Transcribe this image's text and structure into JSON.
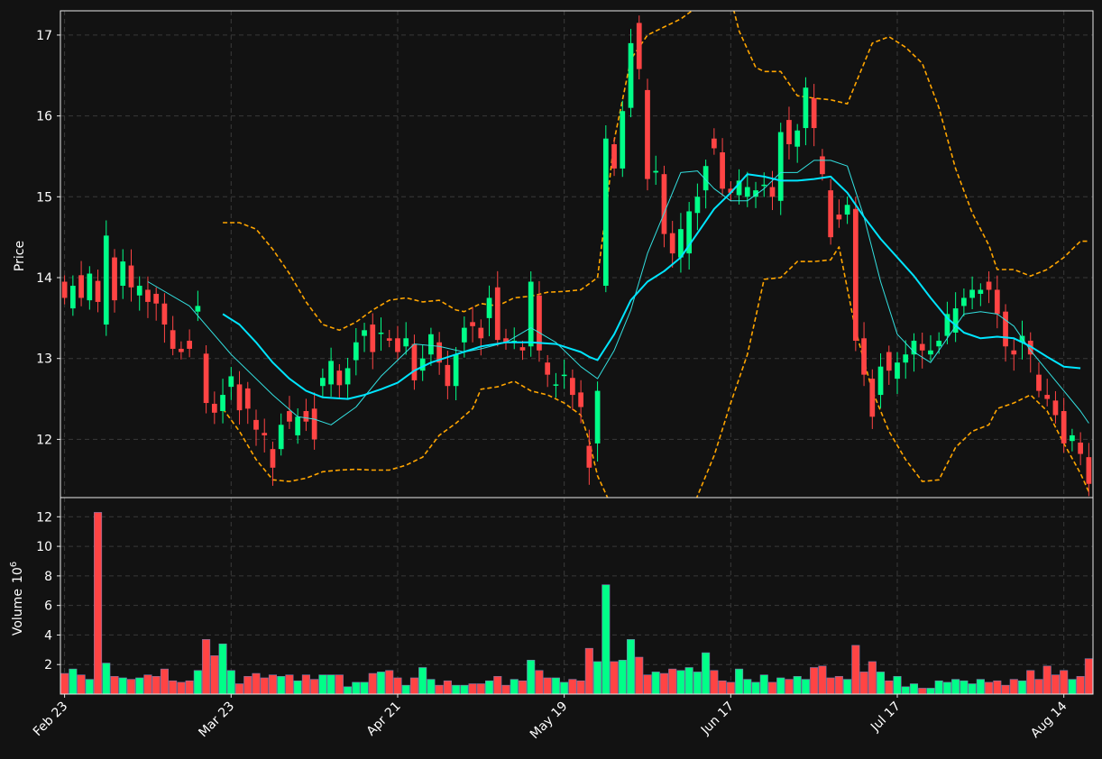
{
  "chart_data": {
    "type": "candlestick",
    "style": {
      "background": "#121212",
      "up_color": "#00ff88",
      "down_color": "#ff4444",
      "ma_fast_color": "#33e0e0",
      "ma_slow_color": "#00e5ff",
      "band_color": "#ffa500",
      "grid": true
    },
    "price_panel": {
      "ylabel": "Price",
      "yticks": [
        12,
        13,
        14,
        15,
        16,
        17
      ],
      "ylim": [
        11.28,
        17.3
      ]
    },
    "volume_panel": {
      "ylabel": "Volume",
      "ylabel_exponent": "6",
      "yticks": [
        2,
        4,
        6,
        8,
        10,
        12
      ],
      "ylim": [
        0,
        13.3
      ],
      "unit_multiplier": 1000000
    },
    "x_ticks": [
      {
        "index": 0,
        "label": "Feb 23"
      },
      {
        "index": 20,
        "label": "Mar 23"
      },
      {
        "index": 40,
        "label": "Apr 21"
      },
      {
        "index": 60,
        "label": "May 19"
      },
      {
        "index": 80,
        "label": "Jun 17"
      },
      {
        "index": 100,
        "label": "Jul 17"
      },
      {
        "index": 120,
        "label": "Aug 14"
      }
    ],
    "n_bars": 124,
    "bars": [
      [
        13.95,
        13.75
      ],
      [
        13.62,
        13.9
      ],
      [
        14.03,
        13.75
      ],
      [
        13.72,
        14.05
      ],
      [
        13.96,
        13.7
      ],
      [
        13.42,
        14.52
      ],
      [
        14.25,
        13.72
      ],
      [
        13.9,
        14.2
      ],
      [
        14.15,
        13.88
      ],
      [
        13.78,
        13.9
      ],
      [
        13.85,
        13.7
      ],
      [
        13.8,
        13.68
      ],
      [
        13.68,
        13.42
      ],
      [
        13.35,
        13.12
      ],
      [
        13.12,
        13.08
      ],
      [
        13.22,
        13.12
      ],
      [
        13.58,
        13.65
      ],
      [
        13.06,
        12.45
      ],
      [
        12.44,
        12.33
      ],
      [
        12.35,
        12.55
      ],
      [
        12.65,
        12.78
      ],
      [
        12.68,
        12.36
      ],
      [
        12.63,
        12.38
      ],
      [
        12.24,
        12.12
      ],
      [
        12.08,
        12.05
      ],
      [
        11.88,
        11.65
      ],
      [
        11.88,
        12.18
      ],
      [
        12.35,
        12.22
      ],
      [
        12.05,
        12.28
      ],
      [
        12.35,
        12.22
      ],
      [
        12.38,
        12.0
      ],
      [
        12.66,
        12.76
      ],
      [
        12.68,
        12.97
      ],
      [
        12.85,
        12.67
      ],
      [
        12.68,
        12.88
      ],
      [
        12.98,
        13.2
      ],
      [
        13.28,
        13.35
      ],
      [
        13.42,
        13.08
      ],
      [
        13.32,
        13.32
      ],
      [
        13.25,
        13.22
      ],
      [
        13.25,
        13.08
      ],
      [
        13.15,
        13.25
      ],
      [
        13.18,
        12.73
      ],
      [
        12.85,
        13.0
      ],
      [
        13.05,
        13.3
      ],
      [
        13.2,
        12.95
      ],
      [
        12.92,
        12.66
      ],
      [
        12.66,
        13.05
      ],
      [
        13.2,
        13.38
      ],
      [
        13.45,
        13.4
      ],
      [
        13.38,
        13.25
      ],
      [
        13.5,
        13.75
      ],
      [
        13.88,
        13.23
      ],
      [
        13.25,
        13.2
      ],
      [
        13.22,
        13.22
      ],
      [
        13.14,
        13.1
      ],
      [
        13.15,
        13.95
      ],
      [
        13.78,
        13.1
      ],
      [
        12.95,
        12.8
      ],
      [
        12.68,
        12.68
      ],
      [
        12.8,
        12.8
      ],
      [
        12.76,
        12.55
      ],
      [
        12.58,
        12.4
      ],
      [
        11.92,
        11.65
      ],
      [
        11.95,
        12.6
      ],
      [
        13.9,
        15.72
      ],
      [
        15.65,
        15.35
      ],
      [
        15.35,
        16.06
      ],
      [
        16.1,
        16.9
      ],
      [
        17.15,
        16.58
      ],
      [
        16.32,
        15.22
      ],
      [
        15.3,
        15.32
      ],
      [
        15.28,
        14.54
      ],
      [
        14.55,
        14.3
      ],
      [
        14.25,
        14.6
      ],
      [
        14.3,
        14.82
      ],
      [
        14.8,
        15.0
      ],
      [
        15.08,
        15.38
      ],
      [
        15.72,
        15.6
      ],
      [
        15.55,
        15.1
      ],
      [
        15.1,
        15.05
      ],
      [
        15.02,
        15.2
      ],
      [
        15.0,
        15.12
      ],
      [
        15.0,
        15.08
      ],
      [
        15.15,
        15.15
      ],
      [
        15.12,
        15.0
      ],
      [
        14.95,
        15.8
      ],
      [
        15.95,
        15.65
      ],
      [
        15.62,
        15.82
      ],
      [
        15.85,
        16.35
      ],
      [
        16.22,
        15.85
      ],
      [
        15.5,
        15.28
      ],
      [
        15.08,
        14.5
      ],
      [
        14.78,
        14.72
      ],
      [
        14.78,
        14.9
      ],
      [
        14.85,
        13.22
      ],
      [
        13.25,
        12.8
      ],
      [
        12.75,
        12.28
      ],
      [
        12.55,
        12.9
      ],
      [
        13.08,
        12.85
      ],
      [
        12.75,
        12.95
      ],
      [
        12.95,
        13.05
      ],
      [
        13.05,
        13.22
      ],
      [
        13.18,
        13.1
      ],
      [
        13.05,
        13.1
      ],
      [
        13.15,
        13.22
      ],
      [
        13.28,
        13.55
      ],
      [
        13.32,
        13.62
      ],
      [
        13.65,
        13.75
      ],
      [
        13.75,
        13.85
      ],
      [
        13.8,
        13.85
      ],
      [
        13.95,
        13.85
      ],
      [
        13.85,
        13.55
      ],
      [
        13.58,
        13.15
      ],
      [
        13.1,
        13.05
      ],
      [
        13.2,
        13.28
      ],
      [
        13.22,
        13.05
      ],
      [
        12.8,
        12.6
      ],
      [
        12.55,
        12.5
      ],
      [
        12.48,
        12.3
      ],
      [
        12.35,
        11.95
      ],
      [
        11.98,
        12.05
      ],
      [
        11.96,
        11.82
      ],
      [
        11.78,
        11.45
      ],
      [
        11.72,
        11.58
      ]
    ],
    "volume_millions": [
      1.4,
      1.7,
      1.3,
      1.0,
      12.3,
      2.1,
      1.2,
      1.1,
      1.0,
      1.1,
      1.3,
      1.2,
      1.7,
      0.9,
      0.8,
      0.9,
      1.6,
      3.7,
      2.6,
      3.4,
      1.6,
      0.7,
      1.2,
      1.4,
      1.1,
      1.3,
      1.2,
      1.3,
      0.9,
      1.3,
      1.0,
      1.3,
      1.3,
      1.3,
      0.5,
      0.8,
      0.8,
      1.4,
      1.5,
      1.6,
      1.1,
      0.6,
      1.1,
      1.8,
      1.0,
      0.6,
      0.9,
      0.6,
      0.6,
      0.7,
      0.7,
      0.9,
      1.2,
      0.6,
      1.0,
      0.9,
      2.3,
      1.6,
      1.1,
      1.1,
      0.8,
      1.0,
      0.9,
      3.1,
      2.2,
      7.4,
      2.2,
      2.3,
      3.7,
      2.5,
      1.3,
      1.5,
      1.4,
      1.7,
      1.6,
      1.8,
      1.5,
      2.8,
      1.6,
      0.9,
      0.8,
      1.7,
      1.0,
      0.8,
      1.3,
      0.8,
      1.1,
      1.0,
      1.2,
      1.0,
      1.8,
      1.9,
      1.1,
      1.2,
      1.0,
      3.3,
      1.5,
      2.2,
      1.5,
      0.9,
      1.2,
      0.5,
      0.7,
      0.4,
      0.4,
      0.9,
      0.8,
      1.0,
      0.9,
      0.7,
      1.0,
      0.8,
      0.9,
      0.6,
      1.0,
      0.9,
      1.6,
      1.0,
      1.9,
      1.3,
      1.6,
      1.0,
      1.2,
      2.4,
      2.6,
      1.4
    ],
    "ma_fast_sampled": [
      [
        10,
        13.95
      ],
      [
        15,
        13.65
      ],
      [
        20,
        13.05
      ],
      [
        25,
        12.55
      ],
      [
        28,
        12.28
      ],
      [
        30,
        12.25
      ],
      [
        32,
        12.18
      ],
      [
        35,
        12.4
      ],
      [
        38,
        12.78
      ],
      [
        40,
        12.98
      ],
      [
        42,
        13.18
      ],
      [
        45,
        13.15
      ],
      [
        48,
        13.08
      ],
      [
        50,
        13.12
      ],
      [
        53,
        13.2
      ],
      [
        56,
        13.38
      ],
      [
        59,
        13.2
      ],
      [
        62,
        12.9
      ],
      [
        64,
        12.75
      ],
      [
        66,
        13.1
      ],
      [
        68,
        13.6
      ],
      [
        70,
        14.3
      ],
      [
        72,
        14.8
      ],
      [
        74,
        15.3
      ],
      [
        76,
        15.32
      ],
      [
        78,
        15.1
      ],
      [
        80,
        14.95
      ],
      [
        82,
        14.95
      ],
      [
        84,
        15.1
      ],
      [
        86,
        15.3
      ],
      [
        88,
        15.3
      ],
      [
        90,
        15.45
      ],
      [
        92,
        15.45
      ],
      [
        94,
        15.38
      ],
      [
        96,
        14.75
      ],
      [
        98,
        13.95
      ],
      [
        100,
        13.3
      ],
      [
        102,
        13.08
      ],
      [
        104,
        12.95
      ],
      [
        106,
        13.25
      ],
      [
        108,
        13.55
      ],
      [
        110,
        13.58
      ],
      [
        112,
        13.55
      ],
      [
        114,
        13.4
      ],
      [
        116,
        13.1
      ],
      [
        118,
        12.85
      ],
      [
        120,
        12.6
      ],
      [
        122,
        12.35
      ],
      [
        123,
        12.2
      ]
    ],
    "ma_slow_sampled": [
      [
        19,
        13.55
      ],
      [
        21,
        13.42
      ],
      [
        23,
        13.2
      ],
      [
        25,
        12.95
      ],
      [
        27,
        12.75
      ],
      [
        29,
        12.6
      ],
      [
        31,
        12.52
      ],
      [
        34,
        12.5
      ],
      [
        36,
        12.55
      ],
      [
        38,
        12.62
      ],
      [
        40,
        12.7
      ],
      [
        42,
        12.85
      ],
      [
        44,
        12.95
      ],
      [
        47,
        13.05
      ],
      [
        50,
        13.15
      ],
      [
        53,
        13.2
      ],
      [
        56,
        13.2
      ],
      [
        59,
        13.18
      ],
      [
        62,
        13.08
      ],
      [
        63,
        13.02
      ],
      [
        64,
        12.98
      ],
      [
        66,
        13.3
      ],
      [
        68,
        13.72
      ],
      [
        70,
        13.95
      ],
      [
        72,
        14.08
      ],
      [
        74,
        14.25
      ],
      [
        76,
        14.55
      ],
      [
        78,
        14.85
      ],
      [
        80,
        15.05
      ],
      [
        82,
        15.28
      ],
      [
        84,
        15.25
      ],
      [
        86,
        15.2
      ],
      [
        88,
        15.2
      ],
      [
        90,
        15.22
      ],
      [
        92,
        15.25
      ],
      [
        94,
        15.05
      ],
      [
        96,
        14.75
      ],
      [
        98,
        14.48
      ],
      [
        100,
        14.25
      ],
      [
        102,
        14.02
      ],
      [
        104,
        13.75
      ],
      [
        106,
        13.5
      ],
      [
        108,
        13.32
      ],
      [
        110,
        13.25
      ],
      [
        112,
        13.27
      ],
      [
        114,
        13.25
      ],
      [
        116,
        13.15
      ],
      [
        118,
        13.02
      ],
      [
        120,
        12.9
      ],
      [
        122,
        12.88
      ]
    ],
    "upper_band_sampled": [
      [
        19,
        14.68
      ],
      [
        21,
        14.68
      ],
      [
        23,
        14.6
      ],
      [
        25,
        14.35
      ],
      [
        27,
        14.05
      ],
      [
        29,
        13.7
      ],
      [
        31,
        13.42
      ],
      [
        33,
        13.35
      ],
      [
        35,
        13.45
      ],
      [
        37,
        13.6
      ],
      [
        39,
        13.72
      ],
      [
        41,
        13.75
      ],
      [
        43,
        13.7
      ],
      [
        45,
        13.72
      ],
      [
        47,
        13.6
      ],
      [
        48,
        13.58
      ],
      [
        50,
        13.68
      ],
      [
        52,
        13.65
      ],
      [
        54,
        13.75
      ],
      [
        56,
        13.77
      ],
      [
        58,
        13.82
      ],
      [
        60,
        13.83
      ],
      [
        62,
        13.85
      ],
      [
        64,
        14.0
      ],
      [
        65,
        14.8
      ],
      [
        66,
        15.7
      ],
      [
        67,
        16.2
      ],
      [
        68,
        16.7
      ],
      [
        70,
        17.0
      ],
      [
        72,
        17.1
      ],
      [
        74,
        17.2
      ],
      [
        76,
        17.35
      ],
      [
        78,
        17.4
      ],
      [
        80,
        17.45
      ],
      [
        81,
        17.05
      ],
      [
        83,
        16.6
      ],
      [
        84,
        16.55
      ],
      [
        86,
        16.55
      ],
      [
        88,
        16.25
      ],
      [
        90,
        16.22
      ],
      [
        92,
        16.2
      ],
      [
        94,
        16.15
      ],
      [
        95,
        16.4
      ],
      [
        97,
        16.9
      ],
      [
        99,
        16.98
      ],
      [
        101,
        16.85
      ],
      [
        103,
        16.65
      ],
      [
        105,
        16.1
      ],
      [
        107,
        15.35
      ],
      [
        109,
        14.8
      ],
      [
        111,
        14.4
      ],
      [
        112,
        14.1
      ],
      [
        114,
        14.1
      ],
      [
        116,
        14.02
      ],
      [
        118,
        14.1
      ],
      [
        120,
        14.25
      ],
      [
        122,
        14.45
      ],
      [
        123,
        14.45
      ]
    ],
    "lower_band_sampled": [
      [
        19,
        12.38
      ],
      [
        21,
        12.1
      ],
      [
        23,
        11.75
      ],
      [
        25,
        11.5
      ],
      [
        27,
        11.48
      ],
      [
        29,
        11.52
      ],
      [
        31,
        11.6
      ],
      [
        33,
        11.62
      ],
      [
        35,
        11.63
      ],
      [
        37,
        11.62
      ],
      [
        39,
        11.62
      ],
      [
        41,
        11.68
      ],
      [
        43,
        11.78
      ],
      [
        45,
        12.05
      ],
      [
        47,
        12.2
      ],
      [
        49,
        12.38
      ],
      [
        50,
        12.62
      ],
      [
        52,
        12.65
      ],
      [
        54,
        12.72
      ],
      [
        56,
        12.6
      ],
      [
        58,
        12.55
      ],
      [
        60,
        12.45
      ],
      [
        62,
        12.3
      ],
      [
        63,
        11.98
      ],
      [
        64,
        11.55
      ],
      [
        66,
        11.1
      ],
      [
        68,
        10.5
      ],
      [
        70,
        10.2
      ],
      [
        72,
        10.3
      ],
      [
        74,
        10.8
      ],
      [
        76,
        11.3
      ],
      [
        78,
        11.8
      ],
      [
        80,
        12.45
      ],
      [
        82,
        13.05
      ],
      [
        84,
        13.98
      ],
      [
        86,
        14.0
      ],
      [
        88,
        14.2
      ],
      [
        90,
        14.2
      ],
      [
        92,
        14.22
      ],
      [
        93,
        14.38
      ],
      [
        95,
        13.35
      ],
      [
        97,
        12.6
      ],
      [
        99,
        12.1
      ],
      [
        101,
        11.75
      ],
      [
        103,
        11.48
      ],
      [
        105,
        11.5
      ],
      [
        107,
        11.9
      ],
      [
        109,
        12.1
      ],
      [
        111,
        12.18
      ],
      [
        112,
        12.38
      ],
      [
        114,
        12.45
      ],
      [
        116,
        12.55
      ],
      [
        118,
        12.35
      ],
      [
        120,
        11.95
      ],
      [
        122,
        11.58
      ],
      [
        123,
        11.35
      ]
    ]
  }
}
